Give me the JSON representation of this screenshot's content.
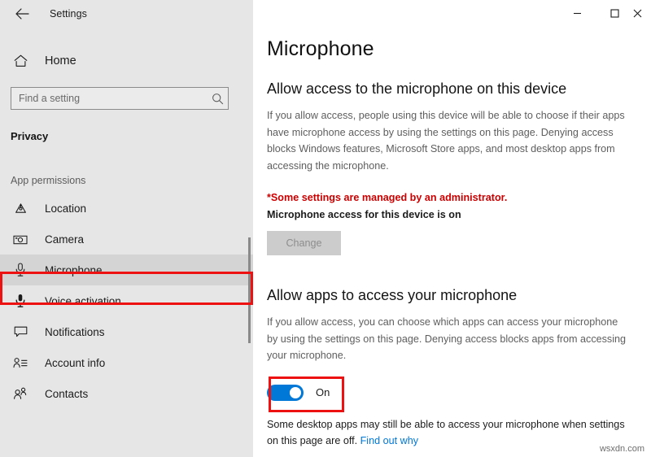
{
  "window": {
    "title": "Settings",
    "back_icon": "back-arrow-icon",
    "controls": {
      "minimize": "minimize-icon",
      "maximize": "maximize-icon",
      "close": "close-icon"
    }
  },
  "sidebar": {
    "home_label": "Home",
    "home_icon": "home-icon",
    "search": {
      "placeholder": "Find a setting",
      "value": "",
      "icon": "search-icon"
    },
    "section_title": "Privacy",
    "group_label": "App permissions",
    "items": [
      {
        "label": "Location",
        "icon": "location-pin-icon",
        "selected": false
      },
      {
        "label": "Camera",
        "icon": "camera-icon",
        "selected": false
      },
      {
        "label": "Microphone",
        "icon": "microphone-icon",
        "selected": true
      },
      {
        "label": "Voice activation",
        "icon": "voice-activation-icon",
        "selected": false
      },
      {
        "label": "Notifications",
        "icon": "notification-icon",
        "selected": false
      },
      {
        "label": "Account info",
        "icon": "account-info-icon",
        "selected": false
      },
      {
        "label": "Contacts",
        "icon": "contacts-icon",
        "selected": false
      }
    ]
  },
  "main": {
    "page_title": "Microphone",
    "device_section": {
      "heading": "Allow access to the microphone on this device",
      "description": "If you allow access, people using this device will be able to choose if their apps have microphone access by using the settings on this page. Denying access blocks Windows features, Microsoft Store apps, and most desktop apps from accessing the microphone.",
      "admin_note": "*Some settings are managed by an administrator.",
      "status": "Microphone access for this device is on",
      "change_button": "Change"
    },
    "apps_section": {
      "heading": "Allow apps to access your microphone",
      "description": "If you allow access, you can choose which apps can access your microphone by using the settings on this page. Denying access blocks apps from accessing your microphone.",
      "toggle_state": "On",
      "toggle_on": true,
      "footer_text": "Some desktop apps may still be able to access your microphone when settings on this page are off.",
      "footer_link": "Find out why"
    }
  },
  "watermark": "wsxdn.com",
  "colors": {
    "accent": "#0078d7",
    "warning": "#cc0000",
    "highlight": "#ee1111",
    "sidebar_bg": "#e6e6e6",
    "selected_bg": "#d4d4d4"
  }
}
